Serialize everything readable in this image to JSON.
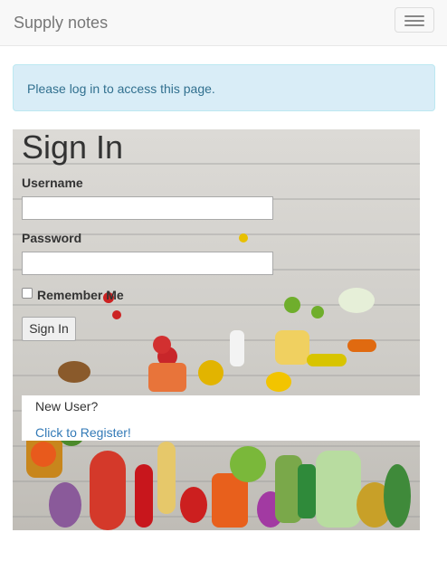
{
  "navbar": {
    "brand": "Supply notes",
    "toggle_icon": "hamburger-icon"
  },
  "alert": {
    "message": "Please log in to access this page."
  },
  "login": {
    "title": "Sign In",
    "username_label": "Username",
    "username_value": "",
    "password_label": "Password",
    "password_value": "",
    "remember_label": "Remember Me",
    "remember_checked": false,
    "submit_label": "Sign In"
  },
  "register": {
    "prompt": "New User?",
    "link_text": "Click to Register!"
  },
  "colors": {
    "alert_bg": "#d9edf7",
    "alert_text": "#31708f",
    "link": "#337ab7",
    "navbar_bg": "#f8f8f8"
  }
}
